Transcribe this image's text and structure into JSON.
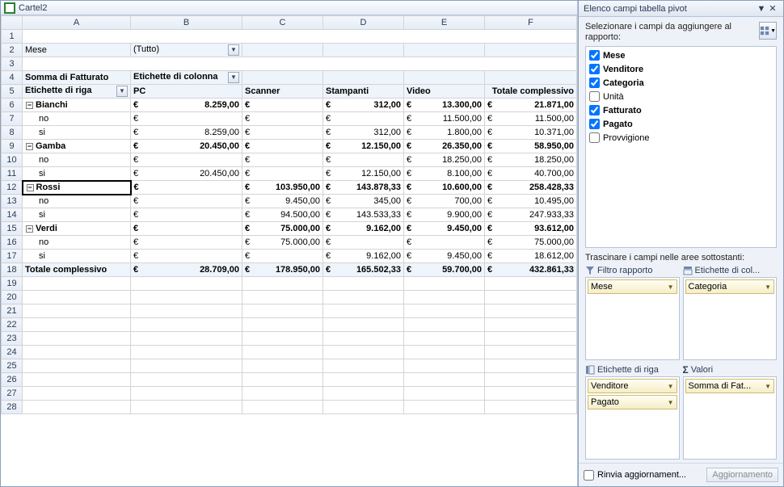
{
  "workbook": {
    "title": "Cartel2"
  },
  "filter_row": {
    "label": "Mese",
    "value": "(Tutto)"
  },
  "headers": {
    "row_labels_title": "Somma di Fatturato",
    "col_labels_title": "Etichette di colonna",
    "row_labels": "Etichette di riga",
    "cols": [
      "PC",
      "Scanner",
      "Stampanti",
      "Video",
      "Totale complessivo"
    ]
  },
  "rows": [
    {
      "k": "bianchi",
      "label": "Bianchi",
      "kind": "group",
      "vals": [
        "8.259,00",
        "",
        "312,00",
        "13.300,00",
        "21.871,00"
      ]
    },
    {
      "k": "bianchi-no",
      "label": "no",
      "kind": "item",
      "vals": [
        "",
        "",
        "",
        "11.500,00",
        "11.500,00"
      ]
    },
    {
      "k": "bianchi-si",
      "label": "si",
      "kind": "item",
      "vals": [
        "8.259,00",
        "",
        "312,00",
        "1.800,00",
        "10.371,00"
      ]
    },
    {
      "k": "gamba",
      "label": "Gamba",
      "kind": "group",
      "vals": [
        "20.450,00",
        "",
        "12.150,00",
        "26.350,00",
        "58.950,00"
      ]
    },
    {
      "k": "gamba-no",
      "label": "no",
      "kind": "item",
      "vals": [
        "",
        "",
        "",
        "18.250,00",
        "18.250,00"
      ]
    },
    {
      "k": "gamba-si",
      "label": "si",
      "kind": "item",
      "vals": [
        "20.450,00",
        "",
        "12.150,00",
        "8.100,00",
        "40.700,00"
      ]
    },
    {
      "k": "rossi",
      "label": "Rossi",
      "kind": "group",
      "vals": [
        "",
        "103.950,00",
        "143.878,33",
        "10.600,00",
        "258.428,33"
      ]
    },
    {
      "k": "rossi-no",
      "label": "no",
      "kind": "item",
      "vals": [
        "",
        "9.450,00",
        "345,00",
        "700,00",
        "10.495,00"
      ]
    },
    {
      "k": "rossi-si",
      "label": "si",
      "kind": "item",
      "vals": [
        "",
        "94.500,00",
        "143.533,33",
        "9.900,00",
        "247.933,33"
      ]
    },
    {
      "k": "verdi",
      "label": "Verdi",
      "kind": "group",
      "vals": [
        "",
        "75.000,00",
        "9.162,00",
        "9.450,00",
        "93.612,00"
      ]
    },
    {
      "k": "verdi-no",
      "label": "no",
      "kind": "item",
      "vals": [
        "",
        "75.000,00",
        "",
        "",
        "75.000,00"
      ]
    },
    {
      "k": "verdi-si",
      "label": "si",
      "kind": "item",
      "vals": [
        "",
        "",
        "9.162,00",
        "9.450,00",
        "18.612,00"
      ]
    }
  ],
  "grand_total": {
    "label": "Totale complessivo",
    "vals": [
      "28.709,00",
      "178.950,00",
      "165.502,33",
      "59.700,00",
      "432.861,33"
    ]
  },
  "pane": {
    "title": "Elenco campi tabella pivot",
    "hint": "Selezionare i campi da aggiungere al rapporto:",
    "fields": [
      {
        "name": "Mese",
        "checked": true
      },
      {
        "name": "Venditore",
        "checked": true
      },
      {
        "name": "Categoria",
        "checked": true
      },
      {
        "name": "Unità",
        "checked": false
      },
      {
        "name": "Fatturato",
        "checked": true
      },
      {
        "name": "Pagato",
        "checked": true
      },
      {
        "name": "Provvigione",
        "checked": false
      }
    ],
    "drag_hint": "Trascinare i campi nelle aree sottostanti:",
    "areas": {
      "filter": {
        "label": "Filtro rapporto",
        "items": [
          "Mese"
        ]
      },
      "cols": {
        "label": "Etichette di col...",
        "items": [
          "Categoria"
        ]
      },
      "rows": {
        "label": "Etichette di riga",
        "items": [
          "Venditore",
          "Pagato"
        ]
      },
      "vals": {
        "label": "Valori",
        "items": [
          "Somma di Fat..."
        ]
      }
    },
    "defer": {
      "label": "Rinvia aggiornament...",
      "button": "Aggiornamento"
    }
  },
  "chart_data": {
    "type": "table",
    "title": "Somma di Fatturato",
    "filter": {
      "Mese": "(Tutto)"
    },
    "columns": [
      "PC",
      "Scanner",
      "Stampanti",
      "Video",
      "Totale complessivo"
    ],
    "rows": [
      {
        "Venditore": "Bianchi",
        "Pagato": null,
        "PC": 8259.0,
        "Scanner": null,
        "Stampanti": 312.0,
        "Video": 13300.0,
        "Totale": 21871.0
      },
      {
        "Venditore": "Bianchi",
        "Pagato": "no",
        "PC": null,
        "Scanner": null,
        "Stampanti": null,
        "Video": 11500.0,
        "Totale": 11500.0
      },
      {
        "Venditore": "Bianchi",
        "Pagato": "si",
        "PC": 8259.0,
        "Scanner": null,
        "Stampanti": 312.0,
        "Video": 1800.0,
        "Totale": 10371.0
      },
      {
        "Venditore": "Gamba",
        "Pagato": null,
        "PC": 20450.0,
        "Scanner": null,
        "Stampanti": 12150.0,
        "Video": 26350.0,
        "Totale": 58950.0
      },
      {
        "Venditore": "Gamba",
        "Pagato": "no",
        "PC": null,
        "Scanner": null,
        "Stampanti": null,
        "Video": 18250.0,
        "Totale": 18250.0
      },
      {
        "Venditore": "Gamba",
        "Pagato": "si",
        "PC": 20450.0,
        "Scanner": null,
        "Stampanti": 12150.0,
        "Video": 8100.0,
        "Totale": 40700.0
      },
      {
        "Venditore": "Rossi",
        "Pagato": null,
        "PC": null,
        "Scanner": 103950.0,
        "Stampanti": 143878.33,
        "Video": 10600.0,
        "Totale": 258428.33
      },
      {
        "Venditore": "Rossi",
        "Pagato": "no",
        "PC": null,
        "Scanner": 9450.0,
        "Stampanti": 345.0,
        "Video": 700.0,
        "Totale": 10495.0
      },
      {
        "Venditore": "Rossi",
        "Pagato": "si",
        "PC": null,
        "Scanner": 94500.0,
        "Stampanti": 143533.33,
        "Video": 9900.0,
        "Totale": 247933.33
      },
      {
        "Venditore": "Verdi",
        "Pagato": null,
        "PC": null,
        "Scanner": 75000.0,
        "Stampanti": 9162.0,
        "Video": 9450.0,
        "Totale": 93612.0
      },
      {
        "Venditore": "Verdi",
        "Pagato": "no",
        "PC": null,
        "Scanner": 75000.0,
        "Stampanti": null,
        "Video": null,
        "Totale": 75000.0
      },
      {
        "Venditore": "Verdi",
        "Pagato": "si",
        "PC": null,
        "Scanner": null,
        "Stampanti": 9162.0,
        "Video": 9450.0,
        "Totale": 18612.0
      }
    ],
    "grand_total": {
      "PC": 28709.0,
      "Scanner": 178950.0,
      "Stampanti": 165502.33,
      "Video": 59700.0,
      "Totale": 432861.33
    }
  }
}
